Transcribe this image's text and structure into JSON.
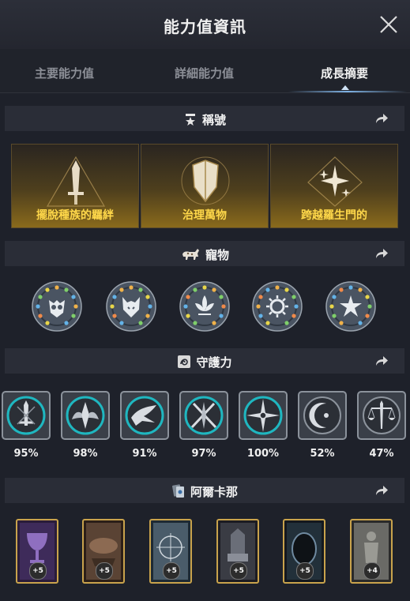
{
  "window": {
    "title": "能力值資訊"
  },
  "tabs": [
    {
      "label": "主要能力值"
    },
    {
      "label": "詳細能力值"
    },
    {
      "label": "成長摘要"
    }
  ],
  "sections": {
    "titles": {
      "label": "稱號"
    },
    "pets": {
      "label": "寵物"
    },
    "guardians": {
      "label": "守護力"
    },
    "arcana": {
      "label": "阿爾卡那"
    }
  },
  "title_cards": [
    {
      "name": "擺脫種族的羈絆",
      "icon": "sword-triangle-icon"
    },
    {
      "name": "治理萬物",
      "icon": "shield-emblem-icon"
    },
    {
      "name": "跨越羅生門的",
      "icon": "star-diamond-icon"
    }
  ],
  "pets": [
    {
      "icon": "owl-pet-icon"
    },
    {
      "icon": "wolf-pet-icon"
    },
    {
      "icon": "lotus-pet-icon"
    },
    {
      "icon": "sun-pet-icon"
    },
    {
      "icon": "flower-pet-icon"
    }
  ],
  "guardians": [
    {
      "percent": "95%",
      "icon": "sword-guardian-icon"
    },
    {
      "percent": "98%",
      "icon": "wings-guardian-icon"
    },
    {
      "percent": "91%",
      "icon": "bird-guardian-icon"
    },
    {
      "percent": "97%",
      "icon": "crossed-blades-guardian-icon"
    },
    {
      "percent": "100%",
      "icon": "compass-guardian-icon"
    },
    {
      "percent": "52%",
      "icon": "moon-guardian-icon"
    },
    {
      "percent": "47%",
      "icon": "scales-guardian-icon"
    }
  ],
  "arcana": [
    {
      "badge": "+5",
      "icon": "chalice-card-icon"
    },
    {
      "badge": "+5",
      "icon": "ruins-card-icon"
    },
    {
      "badge": "+5",
      "icon": "star-map-card-icon"
    },
    {
      "badge": "+5",
      "icon": "throne-card-icon"
    },
    {
      "badge": "+5",
      "icon": "mirror-card-icon"
    },
    {
      "badge": "+4",
      "icon": "statue-card-icon"
    }
  ],
  "colors": {
    "background": "#1e212a",
    "section_bar": "#2a2d37",
    "title_text": "#ffd84a",
    "guardian_ring": "#1fb7c0",
    "tab_active_underline": "#7fb3e6"
  }
}
